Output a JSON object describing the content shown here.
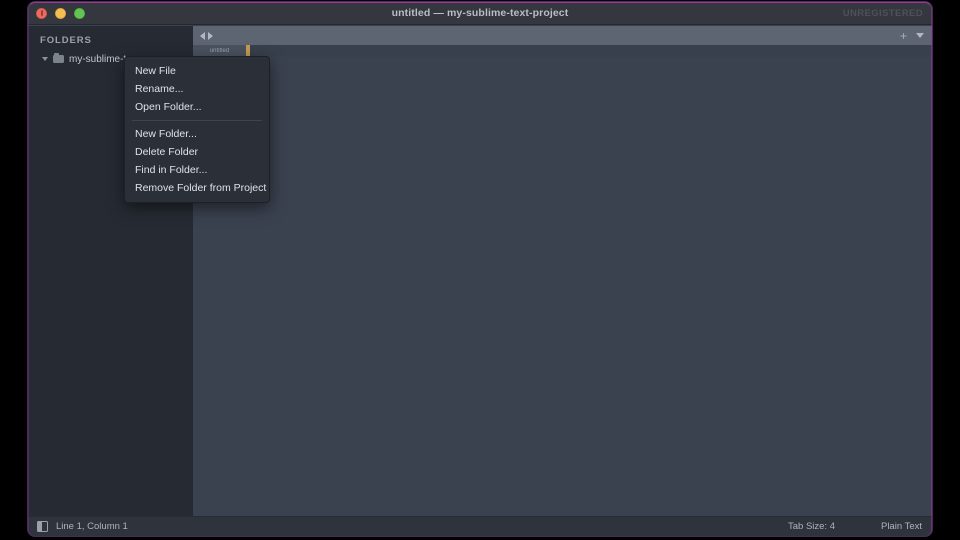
{
  "window": {
    "title": "untitled — my-sublime-text-project",
    "license_badge": "UNREGISTERED",
    "traffic_lights": [
      "close-red",
      "minimize-yellow",
      "maximize-green"
    ]
  },
  "sidebar": {
    "header": "FOLDERS",
    "tree": [
      {
        "label": "my-sublime-t",
        "icon": "folder-icon",
        "expanded": true,
        "disclosure": "triangle-down-icon"
      }
    ]
  },
  "tabbar": {
    "nav_prev_icon": "arrow-left-icon",
    "nav_next_icon": "arrow-right-icon",
    "new_tab_icon": "plus-icon",
    "tab_menu_icon": "chevron-down-icon",
    "active_tab_label": "untitled",
    "active_tab_dirty": true
  },
  "context_menu": {
    "groups": [
      [
        {
          "label": "New File"
        },
        {
          "label": "Rename..."
        },
        {
          "label": "Open Folder..."
        }
      ],
      [
        {
          "label": "New Folder..."
        },
        {
          "label": "Delete Folder"
        },
        {
          "label": "Find in Folder..."
        },
        {
          "label": "Remove Folder from Project"
        }
      ]
    ]
  },
  "statusbar": {
    "sidebar_toggle_icon": "sidebar-panel-icon",
    "cursor_position": "Line 1, Column 1",
    "tab_size": "Tab Size: 4",
    "syntax": "Plain Text"
  },
  "colors": {
    "window_chrome": "#34373d",
    "sidebar_bg": "#262b33",
    "editor_bg": "#3a4250",
    "tabbar_bg": "#5d6472",
    "tabstrip_bg": "#39404d",
    "statusbar_bg": "#2e333c",
    "menu_bg": "#2b3038",
    "text_primary": "#dfe2e7",
    "text_muted": "#9ba1ab",
    "dirty_marker": "#c59b52",
    "frame_fringe": "#be3cbe"
  }
}
